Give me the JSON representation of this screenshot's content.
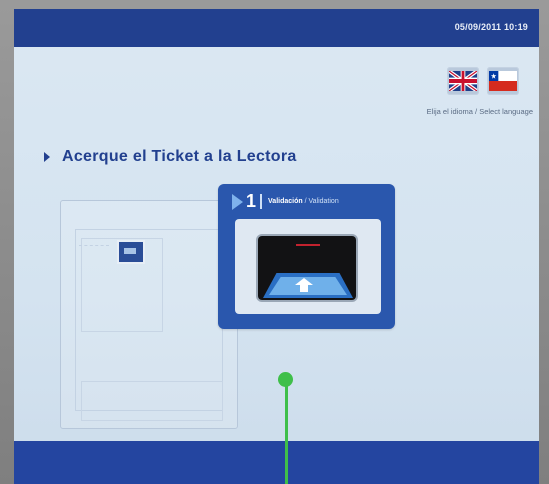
{
  "header": {
    "datetime": "05/09/2011 10:19"
  },
  "language": {
    "options": [
      {
        "name": "uk-flag-icon",
        "label": "English"
      },
      {
        "name": "chile-flag-icon",
        "label": "Español"
      }
    ],
    "prompt": "Elija el idioma / Select language"
  },
  "main": {
    "instruction": "Acerque el Ticket a la Lectora"
  },
  "card": {
    "step_number": "1",
    "label_es": "Validación",
    "label_sep": " / ",
    "label_en": "Validation"
  },
  "colors": {
    "topbar": "#22408f",
    "card": "#2a57ad",
    "accent_green": "#3fbf4a",
    "chile_red": "#d52b1e",
    "chile_blue": "#0039a6"
  }
}
